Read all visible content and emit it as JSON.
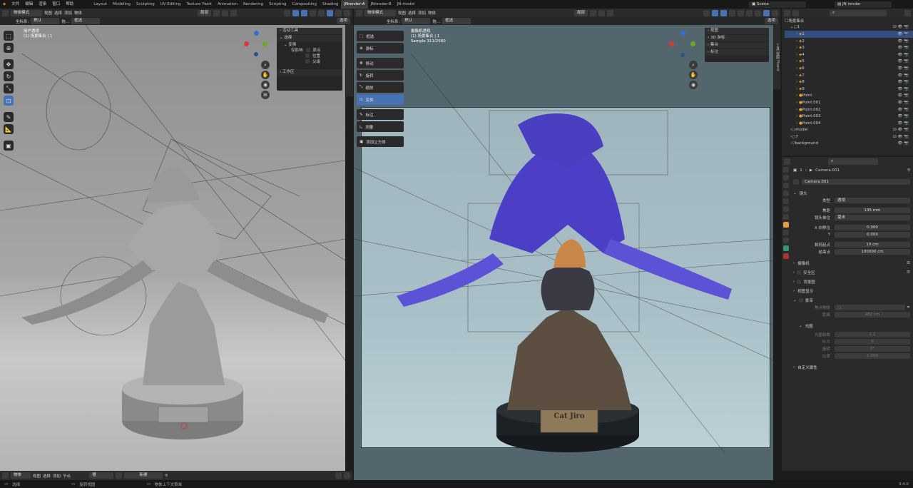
{
  "app": {
    "version": "3.4.0"
  },
  "top_menu": [
    "文件",
    "编辑",
    "渲染",
    "窗口",
    "帮助"
  ],
  "workspaces": [
    "Layout",
    "Modeling",
    "Sculpting",
    "UV Editing",
    "Texture Paint",
    "Animation",
    "Rendering",
    "Scripting",
    "Compositing",
    "Shading",
    "JNrender-A",
    "JNrender-B",
    "JN-model"
  ],
  "active_workspace": "JNrender-A",
  "scene_label": "Scene",
  "view_layer": "JN render",
  "left_view": {
    "mode": "物体模式",
    "menu": [
      "视图",
      "选择",
      "添加",
      "物体"
    ],
    "transform": "局部",
    "coord_label": "坐标系:",
    "coord_value": "默认",
    "drag_label": "拖...",
    "drag_value": "框选",
    "options": "选项",
    "overlay_line1": "用户透视",
    "overlay_line2": "(1) 场景集合 | 1",
    "npanel": {
      "active_tool": "活动工具",
      "select": "选择",
      "transform": "变换",
      "affect_only": "仅影响",
      "origins": "原点",
      "locations": "位置",
      "parents": "父级",
      "workspace": "工作区"
    },
    "tabs": [
      "工具",
      "视图"
    ]
  },
  "right_view": {
    "mode": "物体模式",
    "menu": [
      "视图",
      "选择",
      "添加",
      "物体"
    ],
    "transform": "局部",
    "coord_label": "坐标系:",
    "coord_value": "默认",
    "drag_label": "拖...",
    "drag_value": "框选",
    "options": "选项",
    "overlay_line1": "摄像机透视",
    "overlay_line2": "(1) 场景集合 | 1",
    "overlay_line3": "Sample 311/2560",
    "tools": [
      "框选",
      "游标",
      "移动",
      "旋转",
      "缩放",
      "变换",
      "标注",
      "测量",
      "添加立方体"
    ],
    "active_tool": "变换",
    "npanel": [
      "视图",
      "3D 游标",
      "集合",
      "标注"
    ],
    "tabs": [
      "工具",
      "视图",
      "Fluent"
    ],
    "plaque_title": "Cat Jiro"
  },
  "outliner": {
    "search_placeholder": "",
    "root": "场景集合",
    "collection": "1",
    "items": [
      "1",
      "2",
      "3",
      "4",
      "5",
      "6",
      "7",
      "8",
      "9",
      "Point",
      "Point.001",
      "Point.002",
      "Point.003",
      "Point.004"
    ],
    "model": "model",
    "seven": "7",
    "background": "background"
  },
  "properties": {
    "breadcrumb_num": "1",
    "breadcrumb_obj": "Camera.001",
    "data_name": "Camera.001",
    "lens_section": "镜头",
    "type_label": "类型",
    "type_value": "透视",
    "focal_label": "焦距",
    "focal_value": "135 mm",
    "lens_unit_label": "镜头单位",
    "lens_unit_value": "毫米",
    "shift_x_label": "X 向移位",
    "shift_x_value": "0.000",
    "shift_y_label": "Y",
    "shift_y_value": "0.000",
    "clip_start_label": "裁剪起点",
    "clip_start_value": "10 cm",
    "clip_end_label": "结束点",
    "clip_end_value": "100000 cm",
    "camera_section": "摄像机",
    "safe_areas": "安全区",
    "background_images": "背景图",
    "viewport_display": "视图显示",
    "dof_section": "景深",
    "focus_object_label": "焦点物体",
    "distance_label": "距离",
    "distance_value": "482 cm",
    "aperture_section": "光圈",
    "fstop_label": "光圈级数",
    "fstop_value": "1.2",
    "blades_label": "叶片",
    "blades_value": "0",
    "rotation_label": "旋转",
    "rotation_value": "0°",
    "ratio_label": "比率",
    "ratio_value": "1.000",
    "custom_props": "自定义属性"
  },
  "bottom": {
    "editor_mode": "物体",
    "menu": [
      "视图",
      "选择",
      "添加",
      "节点"
    ],
    "slot": "槽",
    "new_label": "新建",
    "status_select": "选择",
    "status_rotate": "旋转视图",
    "status_context": "物体上下文菜单",
    "version": "3.4.0"
  }
}
